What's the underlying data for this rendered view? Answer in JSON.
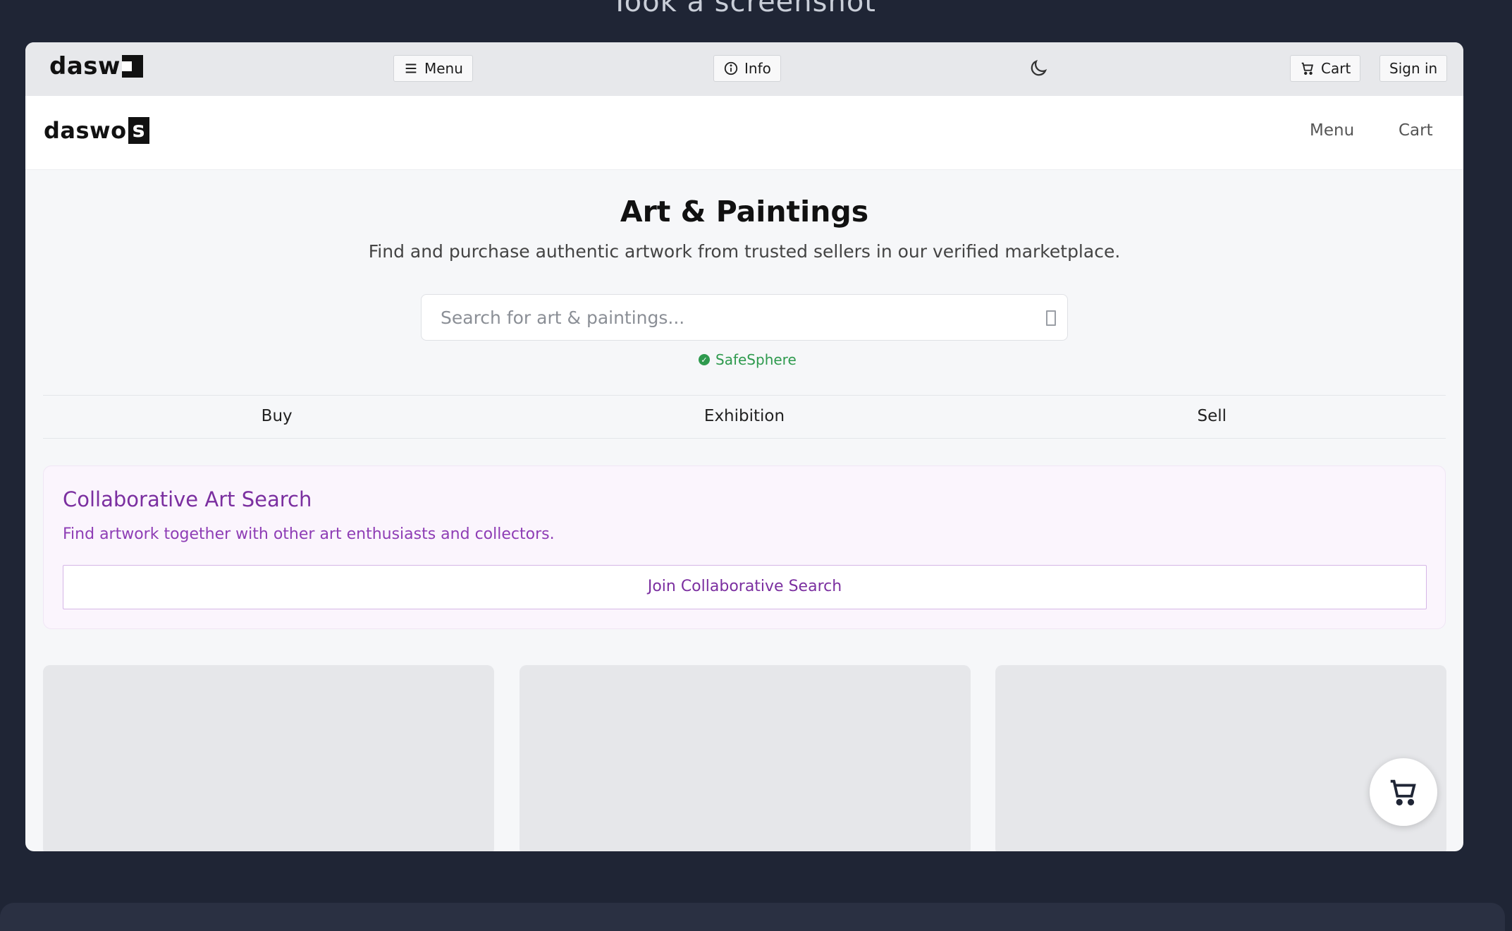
{
  "caption": "Took a screenshot",
  "topbar": {
    "logo_text": "dasw",
    "menu_label": "Menu",
    "info_label": "Info",
    "cart_label": "Cart",
    "signin_label": "Sign in"
  },
  "header": {
    "logo_text": "daswo",
    "logo_box": "s",
    "menu_label": "Menu",
    "cart_label": "Cart"
  },
  "hero": {
    "title": "Art & Paintings",
    "subtitle": "Find and purchase authentic artwork from trusted sellers in our verified marketplace.",
    "search_placeholder": "Search for art & paintings...",
    "safe_label": "SafeSphere"
  },
  "tabs": [
    "Buy",
    "Exhibition",
    "Sell"
  ],
  "collab": {
    "title": "Collaborative Art Search",
    "description": "Find artwork together with other art enthusiasts and collectors.",
    "button_label": "Join Collaborative Search"
  },
  "colors": {
    "accent_purple": "#7b2fa0",
    "safe_green": "#2e9a4e",
    "page_bg": "#1f2535"
  }
}
